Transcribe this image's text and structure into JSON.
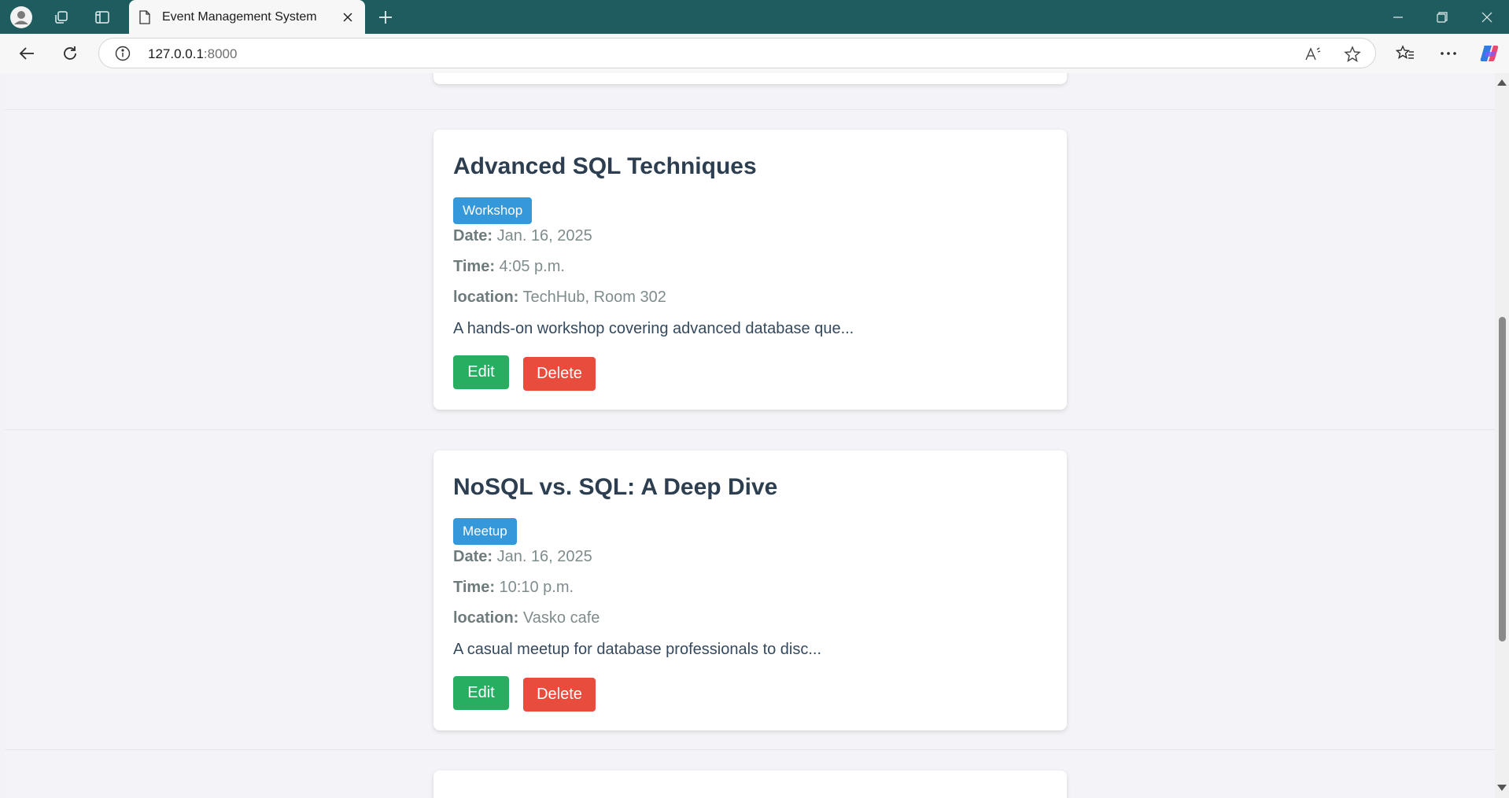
{
  "browser": {
    "tab_title": "Event Management System",
    "url_host": "127.0.0.1",
    "url_port": ":8000"
  },
  "events": [
    {
      "title": "Advanced SQL Techniques",
      "category": "Workshop",
      "date_label": "Date:",
      "date": "Jan. 16, 2025",
      "time_label": "Time:",
      "time": "4:05 p.m.",
      "location_label": "location:",
      "location": "TechHub, Room 302",
      "description": "A hands-on workshop covering advanced database que...",
      "edit_label": "Edit",
      "delete_label": "Delete"
    },
    {
      "title": "NoSQL vs. SQL: A Deep Dive",
      "category": "Meetup",
      "date_label": "Date:",
      "date": "Jan. 16, 2025",
      "time_label": "Time:",
      "time": "10:10 p.m.",
      "location_label": "location:",
      "location": "Vasko cafe",
      "description": "A casual meetup for database professionals to disc...",
      "edit_label": "Edit",
      "delete_label": "Delete"
    }
  ],
  "colors": {
    "badge": "#3498db",
    "edit": "#27ae60",
    "delete": "#e74c3c",
    "titlebar": "#1f5c5f"
  }
}
